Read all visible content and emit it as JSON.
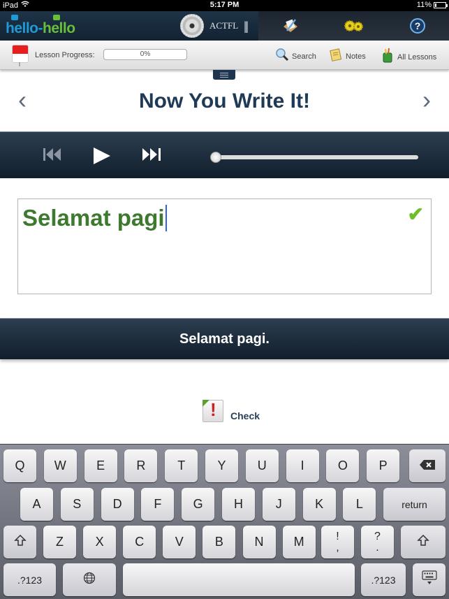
{
  "status_bar": {
    "device": "iPad",
    "time": "5:17 PM",
    "battery": "11%",
    "battery_level": 0.11
  },
  "app_bar": {
    "logo_part1": "hello",
    "logo_dash": "-",
    "logo_part2": "hello",
    "partner": "ACTFL",
    "tool_icons": [
      "notes-pen-icon",
      "settings-gears-icon",
      "help-icon"
    ]
  },
  "toolbar": {
    "lesson_progress_label": "Lesson Progress:",
    "lesson_progress_value": "0%",
    "lesson_progress_fraction": 0,
    "search_label": "Search",
    "notes_label": "Notes",
    "all_lessons_label": "All Lessons"
  },
  "page": {
    "title": "Now You Write It!",
    "prev_arrow": "‹",
    "next_arrow": "›"
  },
  "player": {
    "position_fraction": 0
  },
  "answer": {
    "input_value": "Selamat pagi",
    "status": "correct",
    "reference_text": "Selamat pagi."
  },
  "check_button": {
    "label": "Check"
  },
  "keyboard": {
    "row1": [
      "Q",
      "W",
      "E",
      "R",
      "T",
      "Y",
      "U",
      "I",
      "O",
      "P"
    ],
    "row2": [
      "A",
      "S",
      "D",
      "F",
      "G",
      "H",
      "J",
      "K",
      "L"
    ],
    "row3": [
      "Z",
      "X",
      "C",
      "V",
      "B",
      "N",
      "M"
    ],
    "return_label": "return",
    "numbers_label": ".?123",
    "exclaim_top": "!",
    "exclaim_bottom": ",",
    "question_top": "?",
    "question_bottom": "."
  },
  "colors": {
    "brand_navy": "#1f3a56",
    "correct_green": "#3e7a2e",
    "check_green": "#6cbf2a",
    "logo_blue": "#1e9ad6",
    "logo_green": "#6abf3a"
  }
}
